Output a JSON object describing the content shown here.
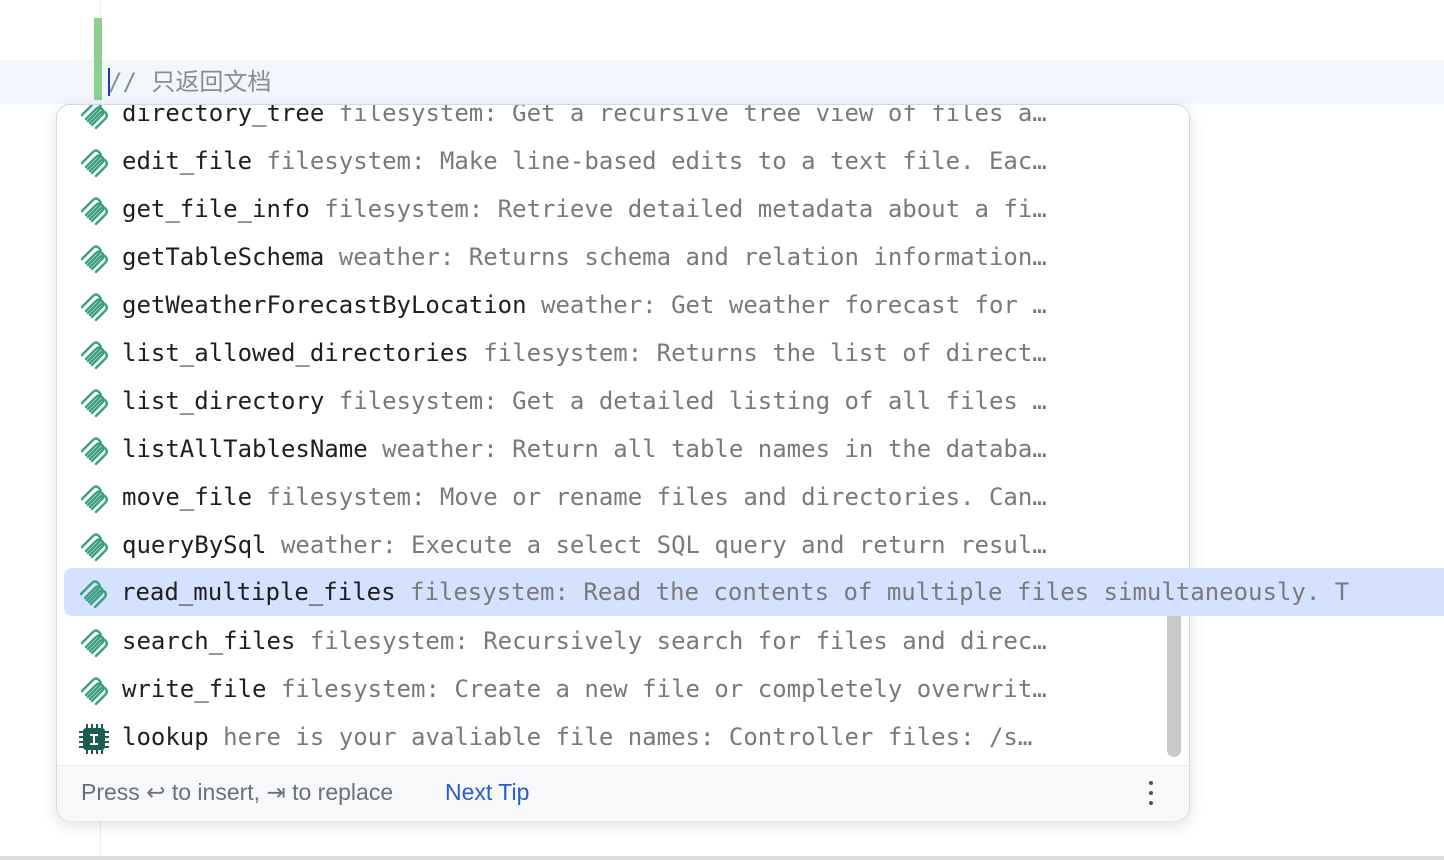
{
  "editor": {
    "code_line": "// 只返回文档"
  },
  "completion": {
    "items": [
      {
        "name": "directory_tree",
        "desc": "filesystem: Get a recursive tree view of files a…",
        "icon": "tool-icon"
      },
      {
        "name": "edit_file",
        "desc": "filesystem: Make line-based edits to a text file. Eac…",
        "icon": "tool-icon"
      },
      {
        "name": "get_file_info",
        "desc": "filesystem: Retrieve detailed metadata about a fi…",
        "icon": "tool-icon"
      },
      {
        "name": "getTableSchema",
        "desc": "weather: Returns schema and relation information…",
        "icon": "tool-icon"
      },
      {
        "name": "getWeatherForecastByLocation",
        "desc": "weather: Get weather forecast for …",
        "icon": "tool-icon"
      },
      {
        "name": "list_allowed_directories",
        "desc": "filesystem: Returns the list of direct…",
        "icon": "tool-icon"
      },
      {
        "name": "list_directory",
        "desc": "filesystem: Get a detailed listing of all files …",
        "icon": "tool-icon"
      },
      {
        "name": "listAllTablesName",
        "desc": "weather: Return all table names in the databa…",
        "icon": "tool-icon"
      },
      {
        "name": "move_file",
        "desc": "filesystem: Move or rename files and directories. Can…",
        "icon": "tool-icon"
      },
      {
        "name": "queryBySql",
        "desc": "weather: Execute a select SQL query and return resul…",
        "icon": "tool-icon"
      },
      {
        "name": "read_multiple_files",
        "desc": "filesystem: Read the contents of multiple files simultaneously. T",
        "icon": "tool-icon",
        "selected": true
      },
      {
        "name": "search_files",
        "desc": "filesystem: Recursively search for files and direc…",
        "icon": "tool-icon"
      },
      {
        "name": "write_file",
        "desc": "filesystem: Create a new file or completely overwrit…",
        "icon": "tool-icon"
      },
      {
        "name": "lookup",
        "desc": "here is your avaliable file names:  Controller files: /s…",
        "icon": "chip-icon"
      }
    ],
    "footer": {
      "hint": "Press ↩ to insert, ⇥ to replace",
      "next_tip": "Next Tip"
    }
  },
  "colors": {
    "selection": "#d4e2ff",
    "tool_icon": "#3aa17e",
    "chip_icon": "#1d5c50",
    "link": "#2a5cc8",
    "vcs_added": "#8ccf8f"
  }
}
